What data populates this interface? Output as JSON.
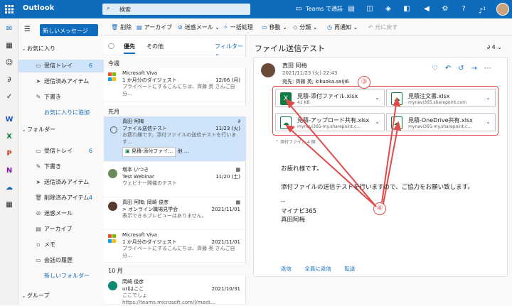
{
  "app": {
    "title": "Outlook",
    "search_placeholder": "検索",
    "teams_label": "Teams で通話",
    "notif_count": "1"
  },
  "nav": {
    "new_message": "新しいメッセージ",
    "favorites_header": "お気に入り",
    "favorites": [
      {
        "label": "受信トレイ",
        "count": "6",
        "icon": "inbox-icon"
      },
      {
        "label": "送信済みアイテム",
        "count": "",
        "icon": "send-icon"
      },
      {
        "label": "下書き",
        "count": "",
        "icon": "pencil-icon"
      }
    ],
    "add_favorite": "お気に入りに追加",
    "folders_header": "フォルダー",
    "folders": [
      {
        "label": "受信トレイ",
        "count": "6",
        "icon": "inbox-icon"
      },
      {
        "label": "下書き",
        "count": "",
        "icon": "pencil-icon"
      },
      {
        "label": "送信済みアイテム",
        "count": "",
        "icon": "send-icon"
      },
      {
        "label": "削除済みアイテム",
        "count": "4",
        "icon": "trash-icon"
      },
      {
        "label": "迷惑メール",
        "count": "",
        "icon": "block-icon"
      },
      {
        "label": "アーカイブ",
        "count": "",
        "icon": "archive-icon"
      },
      {
        "label": "メモ",
        "count": "",
        "icon": "note-icon"
      },
      {
        "label": "会話の履歴",
        "count": "",
        "icon": "folder-icon"
      }
    ],
    "new_folder": "新しいフォルダー",
    "groups_header": "グループ"
  },
  "toolbar": {
    "delete": "削除",
    "archive": "アーカイブ",
    "junk": "迷惑メール",
    "sweep": "一括処理",
    "move": "移動",
    "categorize": "分類",
    "snooze": "再通知",
    "undo": "元に戻す"
  },
  "list": {
    "tab_focused": "優先",
    "tab_other": "その他",
    "filter": "フィルター",
    "group_this_week": "今週",
    "group_last_month": "先月",
    "group_october": "10 月",
    "messages": [
      {
        "from": "Microsoft Viva",
        "subject": "1 か月分のダイジェスト",
        "preview": "プライベートにするこんにちは、齊藤 英 さんご自分…",
        "date": "12/06 (月)"
      },
      {
        "from": "真田 阿梅",
        "subject": "ファイル送信テスト",
        "preview": "お疲れ様です。添付ファイルの送信テストを行います…",
        "date": "11/23 (火)",
        "attachment": "見積-添付ファイ…",
        "more": "他 …"
      },
      {
        "from": "増本 いつき",
        "subject": "Test Webinar",
        "preview": "ウェビナー開催のテスト",
        "date": "11/20 (土)"
      },
      {
        "from": "真田 阿梅; 岡崎 俊彦",
        "subject": "> オンライン職場見学会",
        "preview": "表示できるプレビューはありません。",
        "date": "2021/11/01"
      },
      {
        "from": "Microsoft Viva",
        "subject": "1 か月分のダイジェスト",
        "preview": "プライベートにするこんにちは、齊藤 英 さんご自分…",
        "date": "2021/11/01"
      },
      {
        "from": "岡崎 俊彦",
        "subject": "urlはここ",
        "preview": "ここでしょ https://teams.microsoft.com/l/meet…",
        "date": "2021/10/31"
      }
    ]
  },
  "reading": {
    "subject": "ファイル送信テスト",
    "count": "4",
    "sender": "真田 阿梅",
    "datetime": "2021/11/23 (火) 22:43",
    "to": "宛先: 齊藤 英; kikuoka.seiji6",
    "attachments": [
      {
        "name": "見積-添付ファイル.xlsx",
        "sub": "41 KB",
        "icon": "excel-icon"
      },
      {
        "name": "見積注文書.xlsx",
        "sub": "mynavi365.sharepoint.com",
        "icon": "cloud-excel-icon"
      },
      {
        "name": "見積-アップロード共有.xlsx",
        "sub": "mynavi365-my.sharepoint.c…",
        "icon": "cloud-excel-icon"
      },
      {
        "name": "見積-OneDrive共有.xlsx",
        "sub": "mynavi365-my.sharepoint.c…",
        "icon": "cloud-excel-icon"
      }
    ],
    "attach_summary": "添付ファイル 4 個",
    "body1": "お疲れ様です。",
    "body2": "添付ファイルの送信テストを行いますので、ご協力をお願い致します。",
    "sig1": "--",
    "sig2": "マイナビ365",
    "sig3": "真田阿梅",
    "reply": "返信",
    "reply_all": "全員に返信",
    "forward": "転送",
    "annotation3": "③",
    "annotation4": "④"
  },
  "colors": {
    "brand": "#0f6cbd",
    "annotation": "#e24a4a",
    "excel": "#107c41"
  }
}
